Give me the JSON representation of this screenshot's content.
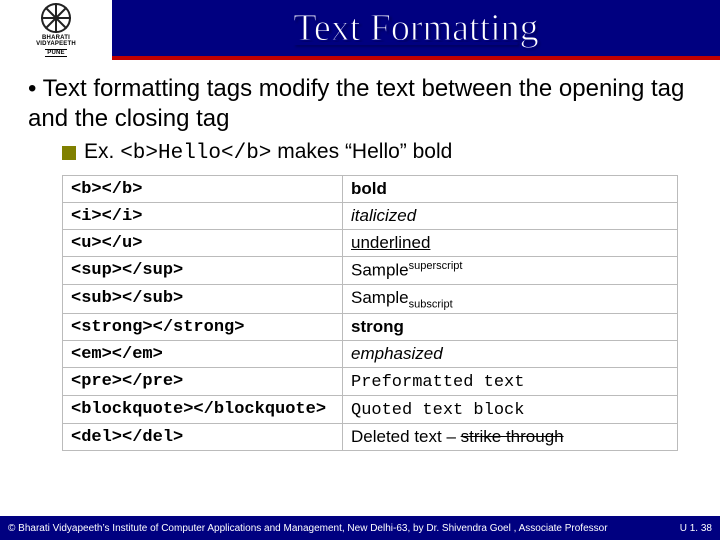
{
  "header": {
    "title": "Text Formatting",
    "logo_line1": "BHARATI",
    "logo_line2": "VIDYAPEETH",
    "logo_line3": "PUNE"
  },
  "body": {
    "bullet1": "Text formatting tags modify the text between the opening tag and the closing tag",
    "bullet2_prefix": "Ex. ",
    "bullet2_code": "<b>Hello</b>",
    "bullet2_suffix": " makes “Hello” bold"
  },
  "rows": [
    {
      "tag": "<b></b>",
      "desc_html": "<b>bold</b>"
    },
    {
      "tag": "<i></i>",
      "desc_html": "<span class='italic'>italicized</span>"
    },
    {
      "tag": "<u></u>",
      "desc_html": "<span class='uline'>underlined</span>"
    },
    {
      "tag": "<sup></sup>",
      "desc_html": "Sample<sup>superscript</sup>"
    },
    {
      "tag": "<sub></sub>",
      "desc_html": "Sample<sub>subscript</sub>"
    },
    {
      "tag": "<strong></strong>",
      "desc_html": "<b>strong</b>"
    },
    {
      "tag": "<em></em>",
      "desc_html": "<span class='italic'>emphasized</span>"
    },
    {
      "tag": "<pre></pre>",
      "desc_html": "<span class='mono'>Preformatted text</span>"
    },
    {
      "tag": "<blockquote></blockquote>",
      "desc_html": "<span class='mono'>Quoted text block</span>"
    },
    {
      "tag": "<del></del>",
      "desc_html": "Deleted text – <span class='strike'>strike through</span>"
    }
  ],
  "footer": {
    "left": "© Bharati Vidyapeeth’s Institute of Computer Applications and Management, New Delhi-63, by Dr. Shivendra Goel , Associate Professor",
    "right": "U 1. 38"
  }
}
